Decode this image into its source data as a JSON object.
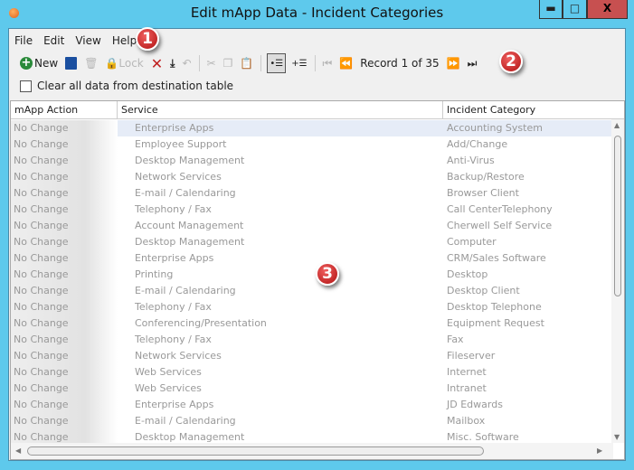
{
  "window": {
    "title": "Edit mApp Data - Incident Categories",
    "min": "▬",
    "max": "□",
    "close": "X"
  },
  "menu": [
    "File",
    "Edit",
    "View",
    "Help"
  ],
  "toolbar": {
    "new": "New",
    "lock": "Lock",
    "record": "Record 1 of 35"
  },
  "clear_checkbox": {
    "label": "Clear all data from destination table",
    "checked": false
  },
  "grid": {
    "headers": [
      "mApp Action",
      "Service",
      "Incident Category"
    ],
    "rows": [
      [
        "No Change",
        "Enterprise Apps",
        "Accounting System"
      ],
      [
        "No Change",
        "Employee Support",
        "Add/Change"
      ],
      [
        "No Change",
        "Desktop Management",
        "Anti-Virus"
      ],
      [
        "No Change",
        "Network Services",
        "Backup/Restore"
      ],
      [
        "No Change",
        "E-mail / Calendaring",
        "Browser Client"
      ],
      [
        "No Change",
        "Telephony / Fax",
        "Call CenterTelephony"
      ],
      [
        "No Change",
        "Account Management",
        "Cherwell Self Service"
      ],
      [
        "No Change",
        "Desktop Management",
        "Computer"
      ],
      [
        "No Change",
        "Enterprise Apps",
        "CRM/Sales Software"
      ],
      [
        "No Change",
        "Printing",
        "Desktop"
      ],
      [
        "No Change",
        "E-mail / Calendaring",
        "Desktop Client"
      ],
      [
        "No Change",
        "Telephony / Fax",
        "Desktop Telephone"
      ],
      [
        "No Change",
        "Conferencing/Presentation",
        "Equipment Request"
      ],
      [
        "No Change",
        "Telephony / Fax",
        "Fax"
      ],
      [
        "No Change",
        "Network Services",
        "Fileserver"
      ],
      [
        "No Change",
        "Web Services",
        "Internet"
      ],
      [
        "No Change",
        "Web Services",
        "Intranet"
      ],
      [
        "No Change",
        "Enterprise Apps",
        "JD Edwards"
      ],
      [
        "No Change",
        "E-mail / Calendaring",
        "Mailbox"
      ],
      [
        "No Change",
        "Desktop Management",
        "Misc. Software"
      ]
    ]
  },
  "callouts": [
    "1",
    "2",
    "3"
  ]
}
